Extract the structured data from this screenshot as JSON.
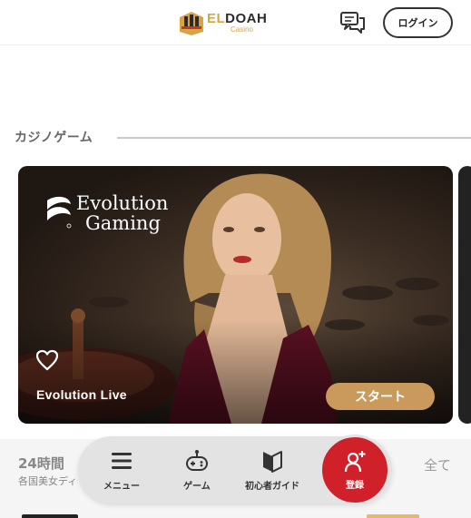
{
  "header": {
    "logo_text_gold": "EL",
    "logo_text_dark": "DOAH",
    "logo_sub": "Casino",
    "chat_icon": "chat-bubbles-icon",
    "login_label": "ログイン"
  },
  "section": {
    "title": "カジノゲーム"
  },
  "card": {
    "brand_line1": "Evolution",
    "brand_line2": "Gaming",
    "brand_reg": "®",
    "label": "Evolution Live",
    "start_label": "スタート",
    "favorite_icon": "heart-outline-icon"
  },
  "row2": {
    "title": "24時間",
    "subtitle": "各国美女ディ",
    "all_label": "全て"
  },
  "bottom_nav": {
    "menu_label": "メニュー",
    "game_label": "ゲーム",
    "guide_label": "初心者ガイド",
    "register_label": "登録"
  },
  "colors": {
    "accent_red": "#d0202a",
    "start_gold": "#c99a5b",
    "logo_gold": "#d9a441"
  }
}
